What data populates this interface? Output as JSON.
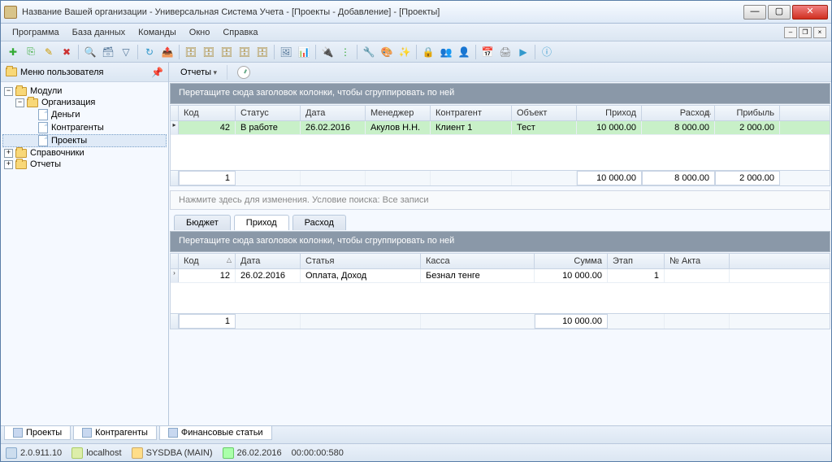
{
  "window": {
    "title": "Название Вашей организации - Универсальная Система Учета - [Проекты - Добавление] - [Проекты]"
  },
  "menu": {
    "program": "Программа",
    "database": "База данных",
    "commands": "Команды",
    "window": "Окно",
    "help": "Справка"
  },
  "sidebar": {
    "title": "Меню пользователя",
    "modules": "Модули",
    "org": "Организация",
    "money": "Деньги",
    "contractors": "Контрагенты",
    "projects": "Проекты",
    "refs": "Справочники",
    "reports": "Отчеты"
  },
  "reports_bar": {
    "label": "Отчеты"
  },
  "group_hint": "Перетащите сюда заголовок колонки, чтобы сгруппировать по ней",
  "main_grid": {
    "headers": {
      "kod": "Код",
      "status": "Статус",
      "date": "Дата",
      "manager": "Менеджер",
      "kontr": "Контрагент",
      "obj": "Объект",
      "income": "Приход",
      "expense": "Расход",
      "profit": "Прибыль"
    },
    "row": {
      "kod": "42",
      "status": "В работе",
      "date": "26.02.2016",
      "manager": "Акулов Н.Н.",
      "kontr": "Клиент 1",
      "obj": "Тест",
      "income": "10 000.00",
      "expense": "8 000.00",
      "profit": "2 000.00"
    },
    "footer": {
      "count": "1",
      "income": "10 000.00",
      "expense": "8 000.00",
      "profit": "2 000.00"
    }
  },
  "filter_hint": "Нажмите здесь для изменения. Условие поиска: Все записи",
  "lower_tabs": {
    "budget": "Бюджет",
    "income": "Приход",
    "expense": "Расход"
  },
  "lower_grid": {
    "headers": {
      "kod": "Код",
      "date": "Дата",
      "article": "Статья",
      "kassa": "Касса",
      "sum": "Сумма",
      "etap": "Этап",
      "akt": "№ Акта"
    },
    "row": {
      "kod": "12",
      "date": "26.02.2016",
      "article": "Оплата, Доход",
      "kassa": "Безнал тенге",
      "sum": "10 000.00",
      "etap": "1",
      "akt": ""
    },
    "footer": {
      "count": "1",
      "sum": "10 000.00"
    }
  },
  "bottom_tabs": {
    "projects": "Проекты",
    "contractors": "Контрагенты",
    "fin": "Финансовые статьи"
  },
  "status": {
    "version": "2.0.911.10",
    "host": "localhost",
    "user": "SYSDBA (MAIN)",
    "date": "26.02.2016",
    "time": "00:00:00:580"
  }
}
